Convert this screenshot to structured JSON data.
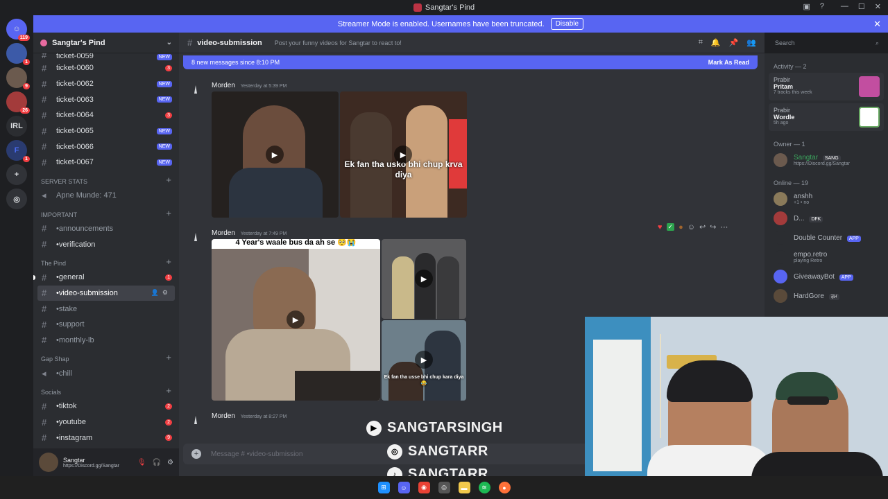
{
  "window": {
    "title": "Sangtar's Pind"
  },
  "banner": {
    "text": "Streamer Mode is enabled. Usernames have been truncated.",
    "disable_label": "Disable"
  },
  "guilds": [
    {
      "label": "",
      "badge": "119"
    },
    {
      "label": "",
      "badge": "1"
    },
    {
      "label": "",
      "badge": "9"
    },
    {
      "label": "",
      "badge": "26"
    },
    {
      "label": "IRL",
      "badge": ""
    },
    {
      "label": "F",
      "badge": "1"
    }
  ],
  "server": {
    "name": "Sangtar's Pind"
  },
  "channels": [
    {
      "name": "ticket-0059",
      "badge": "NEW",
      "badge_type": "new"
    },
    {
      "name": "ticket-0060",
      "badge": "3",
      "badge_type": "red"
    },
    {
      "name": "ticket-0062",
      "badge": "NEW",
      "badge_type": "new"
    },
    {
      "name": "ticket-0063",
      "badge": "NEW",
      "badge_type": "new"
    },
    {
      "name": "ticket-0064",
      "badge": "3",
      "badge_type": "red"
    },
    {
      "name": "ticket-0065",
      "badge": "NEW",
      "badge_type": "new"
    },
    {
      "name": "ticket-0066",
      "badge": "NEW",
      "badge_type": "new"
    },
    {
      "name": "ticket-0067",
      "badge": "NEW",
      "badge_type": "new"
    }
  ],
  "categories": {
    "server_stats": "SERVER STATS",
    "apne_munde": "Apne Munde: 471",
    "important": "IMPORTANT",
    "announcements": "•announcements",
    "verification": "•verification",
    "the_pind": "The Pind",
    "general": "•general",
    "general_badge": "1",
    "video_submission": "•video-submission",
    "stake": "•stake",
    "support": "•support",
    "monthly_lb": "•monthly-lb",
    "gap_shap": "Gap Shap",
    "chill": "•chill",
    "socials": "Socials",
    "tiktok": "•tiktok",
    "tiktok_badge": "2",
    "youtube": "•youtube",
    "youtube_badge": "2",
    "instagram": "•instagram",
    "instagram_badge": "9"
  },
  "user_panel": {
    "name": "Sangtar",
    "status": "https://Discord.gg/Sangtar"
  },
  "chat": {
    "channel_name": "video-submission",
    "topic": "Post your funny videos for Sangtar to react to!",
    "new_messages": "8 new messages since 8:10 PM",
    "mark_as_read": "Mark As Read",
    "composer_placeholder": "Message #  •video-submission",
    "messages": [
      {
        "author": "Morden",
        "time": "Yesterday at 5:39 PM",
        "caption": "Ek fan tha usko bhi chup krva diya"
      },
      {
        "author": "Morden",
        "time": "Yesterday at 7:49 PM",
        "caption": "Ek fan tha usse bhi chup kara diya😂",
        "top_text": "4 Year's waale bus da ah se 🥺😭"
      },
      {
        "author": "Morden",
        "time": "Yesterday at 8:27 PM"
      }
    ]
  },
  "overlay": {
    "youtube": "SANGTARSINGH",
    "instagram": "SANGTARR",
    "tiktok": "SANGTARR"
  },
  "search": {
    "placeholder": "Search"
  },
  "members": {
    "activity_header": "Activity — 2",
    "activities": [
      {
        "user": "Prabir",
        "title": "Pritam",
        "sub": "7 tracks this week"
      },
      {
        "user": "Prabir",
        "title": "Wordle",
        "sub": "5h ago"
      }
    ],
    "owner_header": "Owner — 1",
    "owner": {
      "name": "Sangtar",
      "tag": "SANG",
      "status": "https://Discord.gg/Sangtar"
    },
    "online_header": "Online — 19",
    "online": [
      {
        "name": "anshh",
        "status": "+1 • no",
        "tag": ""
      },
      {
        "name": "D...",
        "status": "",
        "tag": "DFK"
      },
      {
        "name": "Double Counter",
        "status": "",
        "tag": "APP"
      },
      {
        "name": "empo.retro",
        "status": "playing Retro",
        "tag": ""
      },
      {
        "name": "GiveawayBot",
        "status": "",
        "tag": "APP"
      },
      {
        "name": "HardGore",
        "status": "",
        "tag": "ਰਮ"
      }
    ]
  },
  "colors": {
    "accent": "#5865f2",
    "danger": "#f23f43"
  }
}
